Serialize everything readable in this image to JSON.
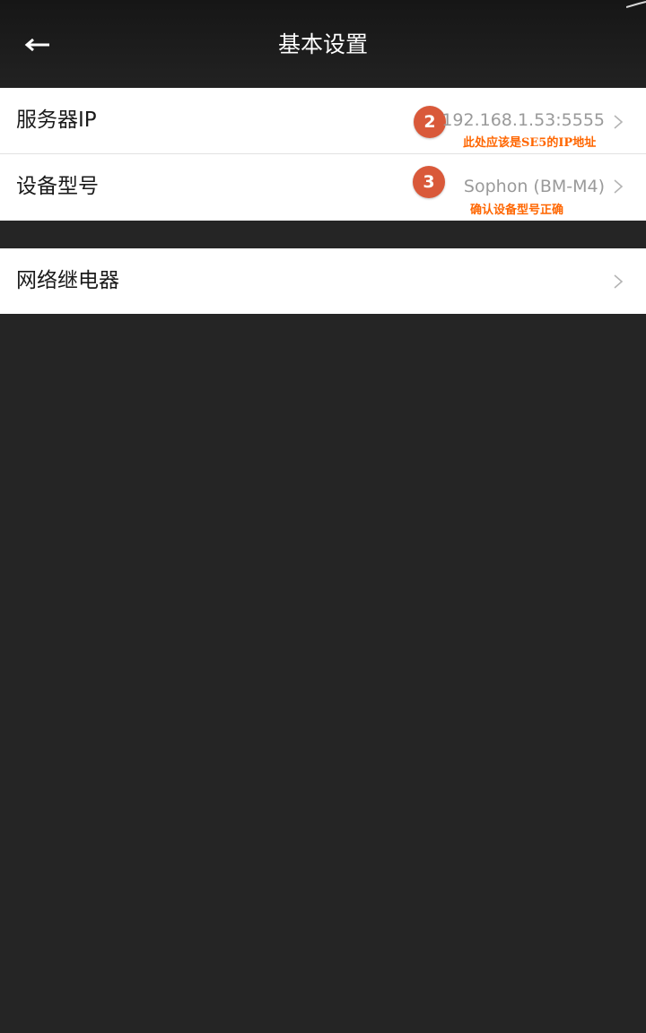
{
  "header": {
    "title": "基本设置",
    "back_icon": "arrow-left-icon"
  },
  "settings": {
    "server_ip": {
      "label": "服务器IP",
      "value": "192.168.1.53:5555"
    },
    "device_model": {
      "label": "设备型号",
      "value": "Sophon (BM-M4)"
    },
    "network_relay": {
      "label": "网络继电器"
    }
  },
  "annotations": [
    {
      "badge": "2",
      "note": "此处应该是SE5的IP地址"
    },
    {
      "badge": "3",
      "note": "确认设备型号正确"
    }
  ],
  "colors": {
    "header_bg": "#1c1c1c",
    "page_bg": "#252525",
    "row_bg": "#ffffff",
    "value_text": "#9a9a9a",
    "badge": "#d9593a",
    "note_text": "#ff6600"
  }
}
